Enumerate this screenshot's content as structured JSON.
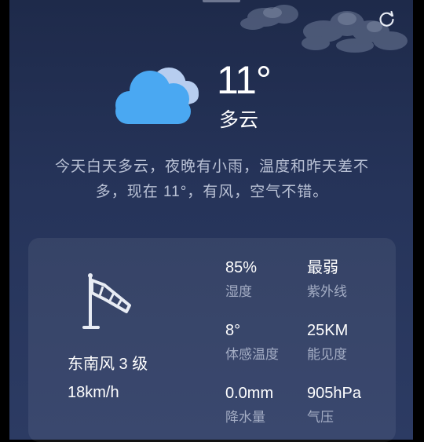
{
  "weather": {
    "temperature": "11°",
    "condition": "多云",
    "summary_line1": "今天白天多云，夜晚有小雨，温度和昨天差不",
    "summary_line2": "多，现在 11°，有风，空气不错。"
  },
  "wind": {
    "direction": "东南风 3 级",
    "speed": "18km/h"
  },
  "stats": [
    {
      "value": "85%",
      "label": "湿度"
    },
    {
      "value": "最弱",
      "label": "紫外线"
    },
    {
      "value": "8°",
      "label": "体感温度"
    },
    {
      "value": "25KM",
      "label": "能见度"
    },
    {
      "value": "0.0mm",
      "label": "降水量"
    },
    {
      "value": "905hPa",
      "label": "气压"
    }
  ],
  "icons": {
    "refresh": "refresh-icon",
    "weather": "cloudy-icon",
    "wind": "windsock-icon"
  },
  "colors": {
    "card_top": "#1e2a4a",
    "card_bottom": "#2c3b63",
    "cloud_front": "#4aa8f2",
    "cloud_back": "#b7cdef",
    "muted_text": "#b8c0d4"
  }
}
